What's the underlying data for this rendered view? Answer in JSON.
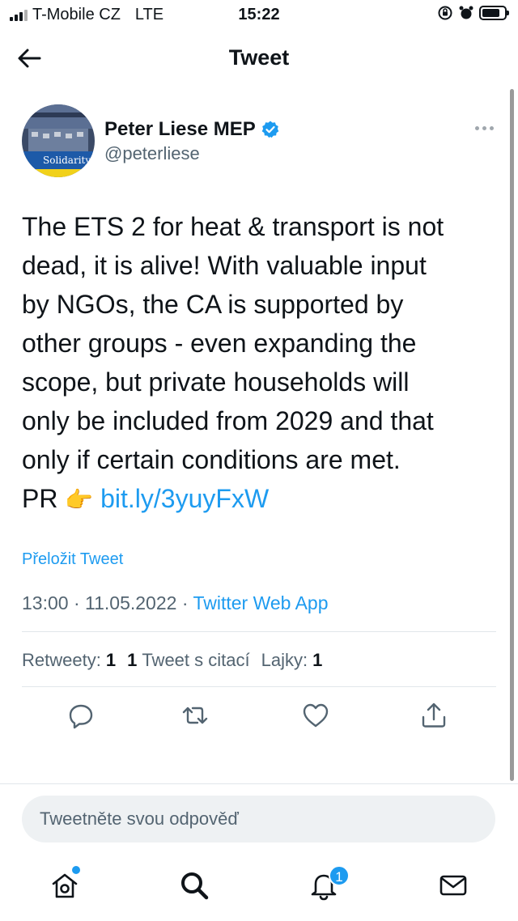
{
  "status_bar": {
    "carrier": "T-Mobile CZ",
    "network": "LTE",
    "time": "15:22"
  },
  "header": {
    "title": "Tweet",
    "back_icon": "arrow-left-icon"
  },
  "tweet": {
    "author_name": "Peter Liese MEP",
    "author_handle": "@peterliese",
    "avatar_label": "Solidarity",
    "text_lines": [
      "The ETS 2 for heat & transport is not",
      "dead, it is alive! With valuable input",
      "by NGOs, the CA is supported by",
      "other groups - even expanding the",
      "scope, but private households will",
      "only be included from 2029 and that",
      "only if certain conditions are met."
    ],
    "pr_prefix": "PR",
    "pr_emoji": "👉",
    "link": "bit.ly/3yuyFxW",
    "translate_label": "Přeložit Tweet",
    "time": "13:00",
    "date": "11.05.2022",
    "separator": "·",
    "source": "Twitter Web App"
  },
  "stats": {
    "retweets_label": "Retweety:",
    "retweets_count": "1",
    "quotes_count": "1",
    "quotes_label": "Tweet s citací",
    "likes_label": "Lajky:",
    "likes_count": "1"
  },
  "reply": {
    "placeholder": "Tweetněte svou odpověď"
  },
  "tabbar": {
    "notifications_badge": "1"
  },
  "colors": {
    "accent": "#1d9bf0",
    "text": "#0f1419",
    "secondary": "#536471"
  }
}
